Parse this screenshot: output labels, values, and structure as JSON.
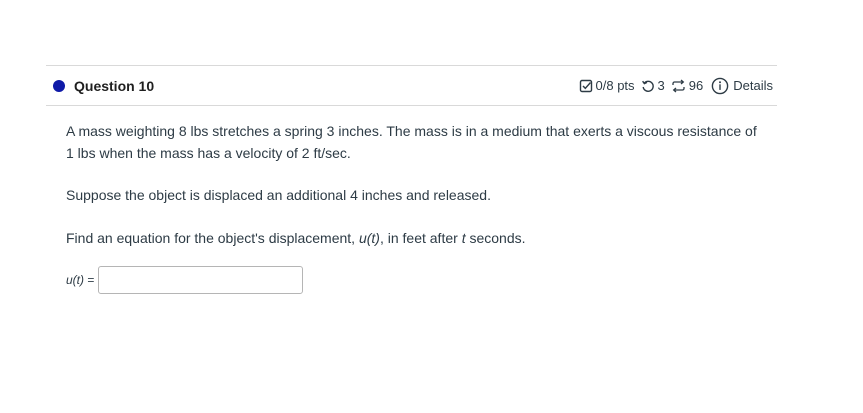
{
  "question": {
    "title": "Question 10",
    "points": "0/8 pts",
    "retries": "3",
    "submissions": "96",
    "details_label": "Details",
    "status_color": "#0f1aa8"
  },
  "body": {
    "paragraph1": "A mass weighting 8 lbs stretches a spring 3 inches. The mass is in a medium that exerts a viscous resistance of 1 lbs when the mass has a velocity of 2 ft/sec.",
    "paragraph2": "Suppose the object is displaced an additional 4 inches and released.",
    "paragraph3_prefix": "Find an equation for the object's displacement, ",
    "paragraph3_var": "u(t)",
    "paragraph3_middle": ", in feet after ",
    "paragraph3_var2": "t",
    "paragraph3_suffix": " seconds."
  },
  "answer": {
    "label_var": "u(t)",
    "label_eq": " =",
    "value": ""
  },
  "icons": {
    "points": "checkbox-icon",
    "retries": "retry-icon",
    "submissions": "submissions-icon",
    "details": "info-icon"
  }
}
